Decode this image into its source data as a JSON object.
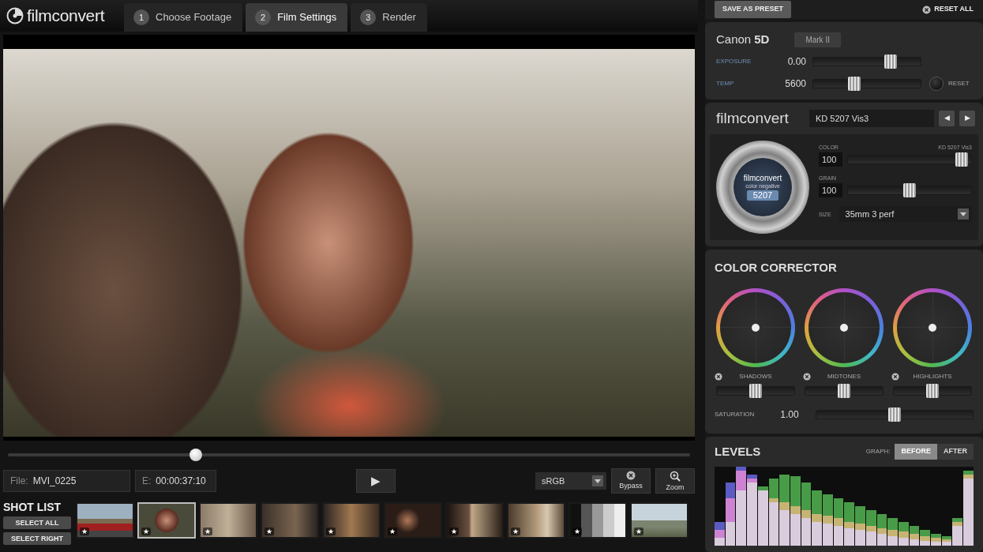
{
  "app": {
    "logo": "filmconvert"
  },
  "tabs": [
    {
      "number": "1",
      "label": "Choose Footage",
      "selected": false
    },
    {
      "number": "2",
      "label": "Film Settings",
      "selected": true
    },
    {
      "number": "3",
      "label": "Render",
      "selected": false
    }
  ],
  "viewer": {
    "playhead": 0.275
  },
  "controls": {
    "file_label": "File:",
    "file": "MVI_0225",
    "time_label": "E:",
    "time": "00:00:37:10",
    "play": "▶",
    "colorspace": "sRGB",
    "bypass": "Bypass",
    "zoom": "Zoom"
  },
  "shot_list": {
    "title": "SHOT LIST",
    "select_all": "SELECT ALL",
    "select_right": "SELECT RIGHT",
    "shots": [
      {
        "star": "★",
        "selected": false
      },
      {
        "star": "★",
        "selected": true
      },
      {
        "star": "★",
        "selected": false
      },
      {
        "star": "★",
        "selected": false
      },
      {
        "star": "★",
        "selected": false
      },
      {
        "star": "★",
        "selected": false
      },
      {
        "star": "★",
        "selected": false
      },
      {
        "star": "★",
        "selected": false
      },
      {
        "star": "★",
        "selected": false
      },
      {
        "star": "★",
        "selected": false
      }
    ]
  },
  "panel": {
    "save_preset": "SAVE AS PRESET",
    "reset_all": "RESET ALL"
  },
  "camera": {
    "make": "Canon",
    "model": "5D",
    "variant": "Mark II",
    "reset": "RESET",
    "sliders": [
      {
        "label": "EXPOSURE",
        "value": "0.00",
        "level": 0.72
      },
      {
        "label": "TEMP",
        "value": "5600",
        "level": 0.38
      }
    ]
  },
  "film": {
    "logo": "filmconvert",
    "stock": "KD 5207 Vis3",
    "prev": "◀",
    "next": "▶",
    "canister": {
      "brand": "filmconvert",
      "type": "color negative",
      "number": "5207"
    },
    "sliders": [
      {
        "label": "COLOR",
        "value": "100",
        "level": 0.92,
        "note": "KD 5207 Vis3"
      },
      {
        "label": "GRAIN",
        "value": "100",
        "level": 0.5
      }
    ],
    "size_label": "SIZE",
    "size": "35mm 3 perf"
  },
  "color_corrector": {
    "title": "COLOR CORRECTOR",
    "wheels": [
      {
        "label": "SHADOWS",
        "puck": {
          "x": 0,
          "y": 0
        },
        "level": 0.5
      },
      {
        "label": "MIDTONES",
        "puck": {
          "x": 0,
          "y": 0
        },
        "level": 0.5
      },
      {
        "label": "HIGHLIGHTS",
        "puck": {
          "x": 0,
          "y": 0
        },
        "level": 0.5
      }
    ],
    "saturation": {
      "label": "SATURATION",
      "value": "1.00",
      "level": 0.5
    }
  },
  "levels": {
    "title": "LEVELS",
    "graph_label": "GRAPH:",
    "modes": [
      {
        "label": "BEFORE",
        "selected": true
      },
      {
        "label": "AFTER",
        "selected": false
      }
    ],
    "histogram": [
      {
        "color": "#d04848",
        "values": [
          20,
          60,
          95,
          85,
          70,
          60,
          55,
          50,
          45,
          40,
          38,
          35,
          30,
          28,
          25,
          22,
          20,
          18,
          15,
          12,
          10,
          8,
          30,
          90
        ]
      },
      {
        "color": "#48b048",
        "values": [
          10,
          30,
          70,
          80,
          75,
          85,
          90,
          88,
          80,
          70,
          65,
          60,
          55,
          50,
          45,
          40,
          35,
          30,
          25,
          20,
          15,
          12,
          35,
          95
        ]
      },
      {
        "color": "#6060e0",
        "values": [
          30,
          80,
          100,
          90,
          70,
          55,
          45,
          40,
          35,
          30,
          28,
          25,
          22,
          20,
          18,
          15,
          12,
          10,
          8,
          6,
          5,
          5,
          25,
          85
        ]
      }
    ]
  }
}
